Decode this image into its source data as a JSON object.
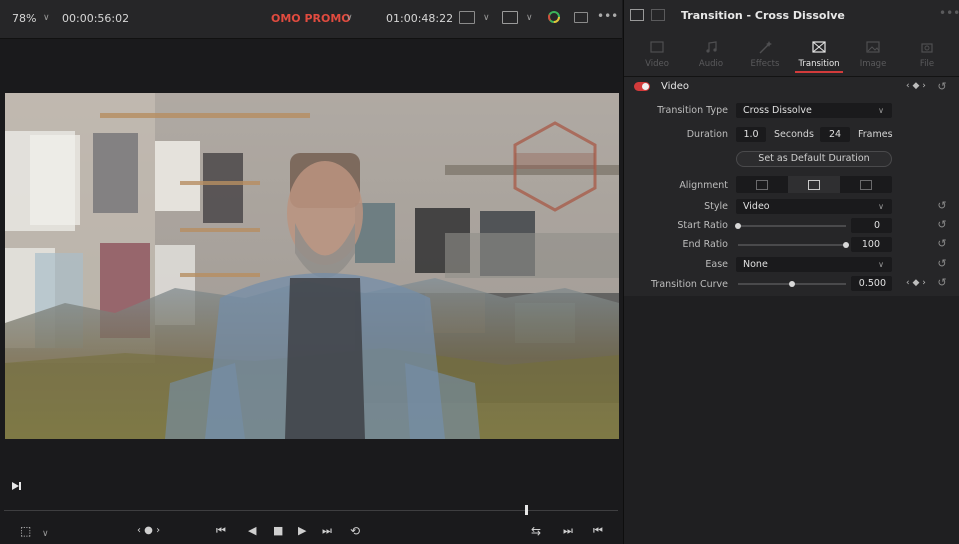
{
  "viewer": {
    "zoom": "78%",
    "source_timecode": "00:00:56:02",
    "timeline_name": "OMO PROMO",
    "record_timecode": "01:00:48:22",
    "playhead_fraction": 0.85
  },
  "inspector": {
    "title": "Transition - Cross Dissolve",
    "tabs": [
      {
        "label": "Video",
        "icon": "video-icon",
        "active": false
      },
      {
        "label": "Audio",
        "icon": "music-note-icon",
        "active": false
      },
      {
        "label": "Effects",
        "icon": "magic-wand-icon",
        "active": false
      },
      {
        "label": "Transition",
        "icon": "transition-icon",
        "active": true
      },
      {
        "label": "Image",
        "icon": "image-icon",
        "active": false
      },
      {
        "label": "File",
        "icon": "file-icon",
        "active": false
      }
    ],
    "section_title": "Video",
    "transition_type_label": "Transition Type",
    "transition_type_value": "Cross Dissolve",
    "duration_label": "Duration",
    "duration_seconds": "1.0",
    "seconds_label": "Seconds",
    "duration_frames": "24",
    "frames_label": "Frames",
    "set_default_label": "Set as Default Duration",
    "alignment_label": "Alignment",
    "style_label": "Style",
    "style_value": "Video",
    "start_ratio_label": "Start Ratio",
    "start_ratio_value": "0",
    "start_ratio_fraction": 0.0,
    "end_ratio_label": "End Ratio",
    "end_ratio_value": "100",
    "end_ratio_fraction": 1.0,
    "ease_label": "Ease",
    "ease_value": "None",
    "transition_curve_label": "Transition Curve",
    "transition_curve_value": "0.500",
    "transition_curve_fraction": 0.5
  },
  "colors": {
    "accent_red": "#d23b3b",
    "panel": "#262628",
    "background": "#1a1a1c"
  }
}
